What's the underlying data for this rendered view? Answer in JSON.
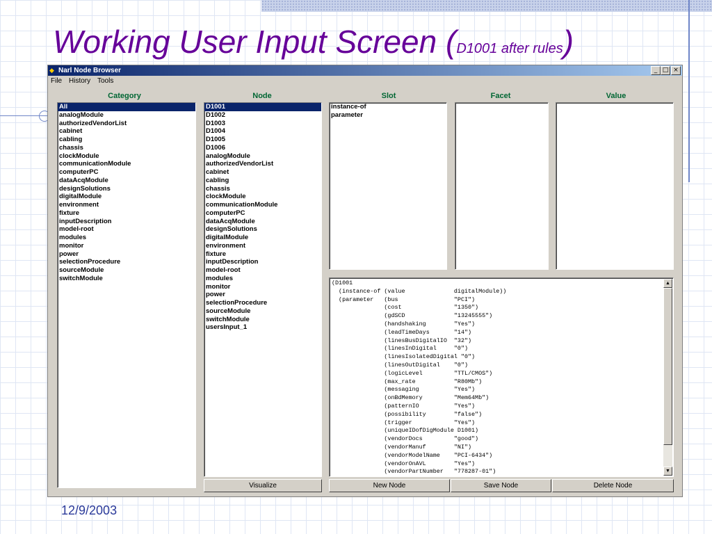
{
  "slide": {
    "title_main": "Working User Input Screen (",
    "title_small": "D1001 after rules",
    "title_close": ")",
    "date": "12/9/2003"
  },
  "window": {
    "title": "Narl Node Browser",
    "controls": {
      "minimize": "_",
      "maximize": "□",
      "close": "×"
    },
    "menu": [
      "File",
      "History",
      "Tools"
    ]
  },
  "columns": {
    "category": "Category",
    "node": "Node",
    "slot": "Slot",
    "facet": "Facet",
    "value": "Value"
  },
  "category_list": {
    "selected": "All",
    "items": [
      "All",
      "analogModule",
      "authorizedVendorList",
      "cabinet",
      "cabling",
      "chassis",
      "clockModule",
      "communicationModule",
      "computerPC",
      "dataAcqModule",
      "designSolutions",
      "digitalModule",
      "environment",
      "fixture",
      "inputDescription",
      "model-root",
      "modules",
      "monitor",
      "power",
      "selectionProcedure",
      "sourceModule",
      "switchModule"
    ]
  },
  "node_list": {
    "selected": "D1001",
    "items": [
      "D1001",
      "D1002",
      "D1003",
      "D1004",
      "D1005",
      "D1006",
      "analogModule",
      "authorizedVendorList",
      "cabinet",
      "cabling",
      "chassis",
      "clockModule",
      "communicationModule",
      "computerPC",
      "dataAcqModule",
      "designSolutions",
      "digitalModule",
      "environment",
      "fixture",
      "inputDescription",
      "model-root",
      "modules",
      "monitor",
      "power",
      "selectionProcedure",
      "sourceModule",
      "switchModule",
      "usersInput_1"
    ]
  },
  "slot_list": {
    "items": [
      "instance-of",
      "parameter"
    ]
  },
  "detail_text": [
    "(D1001",
    "  (instance-of (value              digitalModule))",
    "  (parameter   (bus                \"PCI\")",
    "               (cost               \"1350\")",
    "               (gdSCD              \"13245555\")",
    "               (handshaking        \"Yes\")",
    "               (leadTimeDays       \"14\")",
    "               (linesBusDigitalIO  \"32\")",
    "               (linesInDigital     \"0\")",
    "               (linesIsolatedDigital \"0\")",
    "               (linesOutDigital    \"0\")",
    "               (logicLevel         \"TTL/CMOS\")",
    "               (max_rate           \"R80Mb\")",
    "               (messaging          \"Yes\")",
    "               (onBdMemory         \"Mem64Mb\")",
    "               (patternIO          \"Yes\")",
    "               (possibility        \"false\")",
    "               (trigger            \"Yes\")",
    "               (uniqueIDofDigModule D1001)",
    "               (vendorDocs         \"good\")",
    "               (vendorManuf        \"NI\")",
    "               (vendorModelName    \"PCI-6434\")",
    "               (vendorOnAVL        \"Yes\")",
    "               (vendorPartNumber   \"778287-01\")"
  ],
  "buttons": {
    "visualize": "Visualize",
    "new_node": "New Node",
    "save_node": "Save Node",
    "delete_node": "Delete Node"
  },
  "scroll": {
    "up": "▲",
    "down": "▼"
  },
  "icons": {
    "app": "app-icon"
  }
}
